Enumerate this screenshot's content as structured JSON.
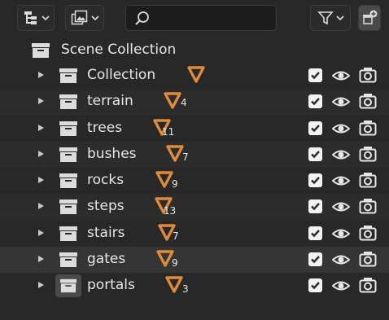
{
  "toolbar": {
    "display_mode_icon": "outliner-tree-icon",
    "view_layer_icon": "image-stack-icon",
    "search": {
      "value": "",
      "placeholder": ""
    },
    "filter_icon": "funnel-icon",
    "new_collection_icon": "new-collection-icon"
  },
  "scene": {
    "label": "Scene Collection"
  },
  "collections": [
    {
      "label": "Collection",
      "count": ""
    },
    {
      "label": "terrain",
      "count": "4"
    },
    {
      "label": "trees",
      "count": "11"
    },
    {
      "label": "bushes",
      "count": "7"
    },
    {
      "label": "rocks",
      "count": "9"
    },
    {
      "label": "steps",
      "count": "13"
    },
    {
      "label": "stairs",
      "count": "7"
    },
    {
      "label": "gates",
      "count": "9"
    },
    {
      "label": "portals",
      "count": "3"
    }
  ],
  "colors": {
    "background": "#282828",
    "cone": "#e08a3c",
    "text": "#e6e6e6"
  }
}
